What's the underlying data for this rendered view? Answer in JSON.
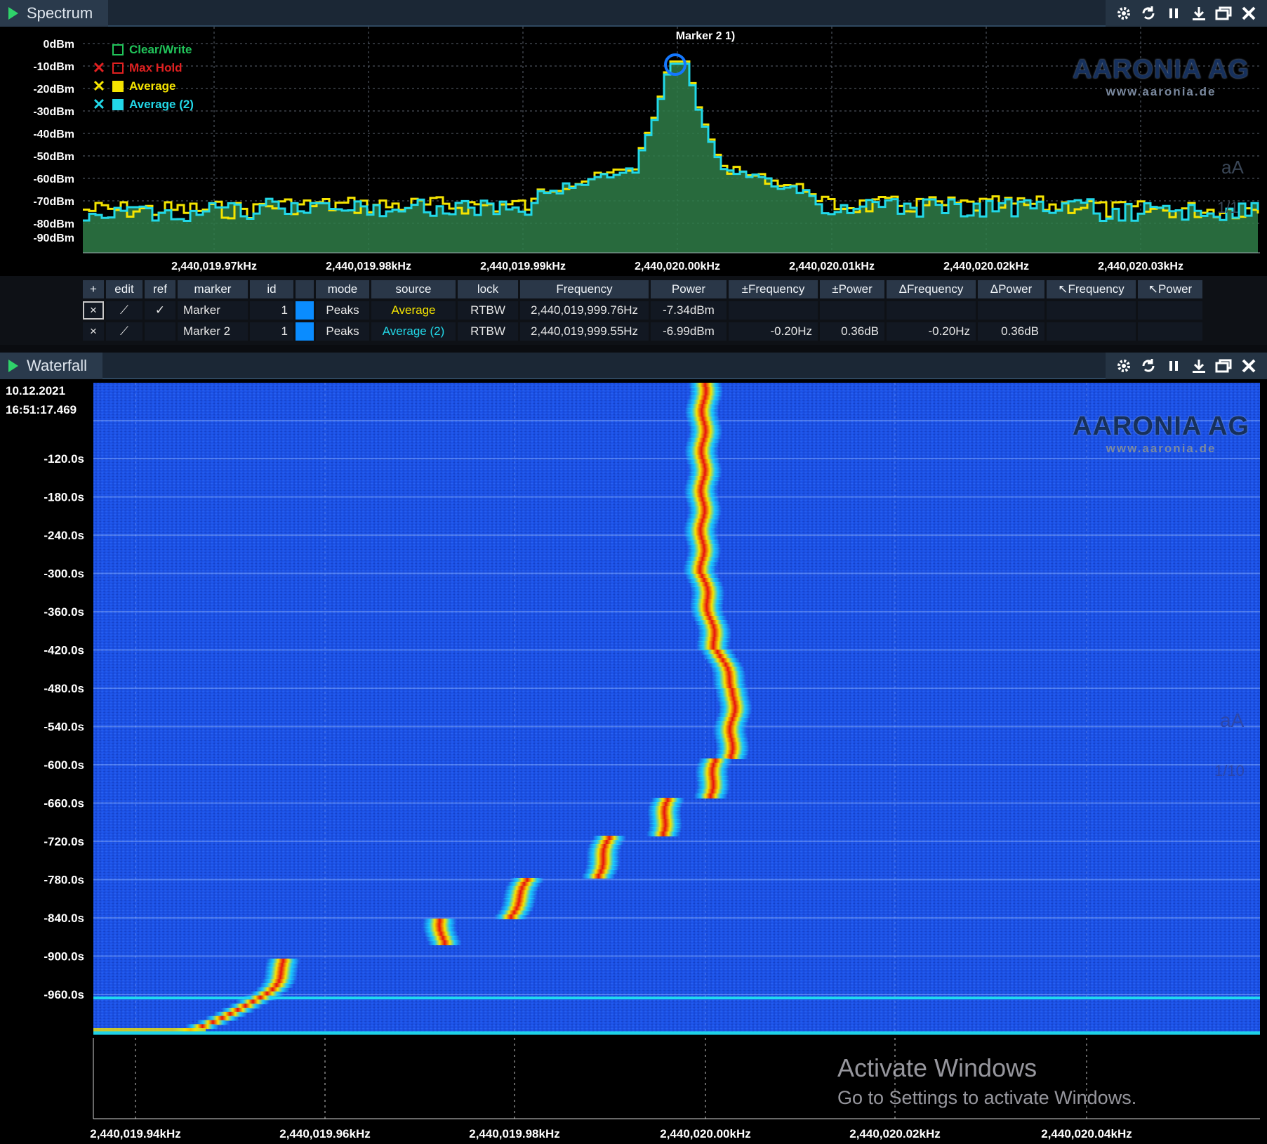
{
  "spectrum": {
    "title": "Spectrum",
    "y_labels": [
      "0dBm",
      "-10dBm",
      "-20dBm",
      "-30dBm",
      "-40dBm",
      "-50dBm",
      "-60dBm",
      "-70dBm",
      "-80dBm",
      "-90dBm"
    ],
    "x_labels": [
      "2,440,019.97kHz",
      "2,440,019.98kHz",
      "2,440,019.99kHz",
      "2,440,020.00kHz",
      "2,440,020.01kHz",
      "2,440,020.02kHz",
      "2,440,020.03kHz"
    ],
    "marker_label": "Marker 2 1)",
    "legend": [
      {
        "label": "Clear/Write",
        "color": "#21c45a",
        "x_icon": ""
      },
      {
        "label": "Max Hold",
        "color": "#e02020",
        "x_icon": "✕"
      },
      {
        "label": "Average",
        "color": "#f5e400",
        "x_icon": "✕"
      },
      {
        "label": "Average (2)",
        "color": "#22d8e8",
        "x_icon": "✕"
      }
    ],
    "logo": "AARONIA AG",
    "logo_url": "www.aaronia.de",
    "side_tools": [
      "aA",
      "1/1"
    ]
  },
  "toolbar_icons": [
    "gear-icon",
    "sync-icon",
    "pause-icon",
    "download-icon",
    "restore-window-icon",
    "close-icon"
  ],
  "marker_table": {
    "headers": [
      "+",
      "edit",
      "ref",
      "marker",
      "id",
      "",
      "mode",
      "source",
      "lock",
      "Frequency",
      "Power",
      "±Frequency",
      "±Power",
      "ΔFrequency",
      "ΔPower",
      "↖Frequency",
      "↖Power"
    ],
    "rows": [
      {
        "add": "×",
        "edit": "⟋",
        "ref": "✓",
        "marker": "Marker",
        "id": "1",
        "mode": "Peaks",
        "source": "Average",
        "source_color": "#f5e400",
        "lock": "RTBW",
        "frequency": "2,440,019,999.76Hz",
        "power": "-7.34dBm",
        "pm_frequency": "",
        "pm_power": "",
        "d_frequency": "",
        "d_power": "",
        "r_frequency": "",
        "r_power": ""
      },
      {
        "add": "×",
        "edit": "⟋",
        "ref": "",
        "marker": "Marker 2",
        "id": "1",
        "mode": "Peaks",
        "source": "Average (2)",
        "source_color": "#22d8e8",
        "lock": "RTBW",
        "frequency": "2,440,019,999.55Hz",
        "power": "-6.99dBm",
        "pm_frequency": "-0.20Hz",
        "pm_power": "0.36dB",
        "d_frequency": "-0.20Hz",
        "d_power": "0.36dB",
        "r_frequency": "",
        "r_power": ""
      }
    ]
  },
  "waterfall": {
    "title": "Waterfall",
    "date": "10.12.2021",
    "time": "16:51:17.469",
    "y_labels": [
      "-120.0s",
      "-180.0s",
      "-240.0s",
      "-300.0s",
      "-360.0s",
      "-420.0s",
      "-480.0s",
      "-540.0s",
      "-600.0s",
      "-660.0s",
      "-720.0s",
      "-780.0s",
      "-840.0s",
      "-900.0s",
      "-960.0s"
    ],
    "x_labels": [
      "2,440,019.94kHz",
      "2,440,019.96kHz",
      "2,440,019.98kHz",
      "2,440,020.00kHz",
      "2,440,020.02kHz",
      "2,440,020.04kHz"
    ],
    "logo": "AARONIA AG",
    "logo_url": "www.aaronia.de",
    "side_tools": [
      "aA",
      "1/10"
    ]
  },
  "activate_windows": {
    "title": "Activate Windows",
    "subtitle": "Go to Settings to activate Windows."
  }
}
